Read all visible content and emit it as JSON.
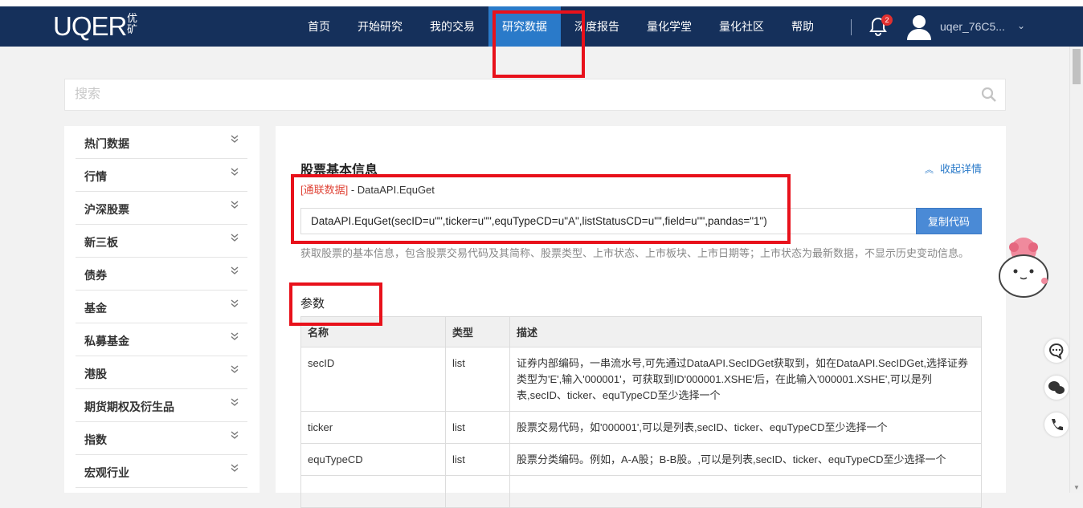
{
  "header": {
    "logo_text": "UQER",
    "logo_sub": "优矿",
    "nav": [
      {
        "label": "首页"
      },
      {
        "label": "开始研究"
      },
      {
        "label": "我的交易"
      },
      {
        "label": "研究数据",
        "active": true
      },
      {
        "label": "深度报告"
      },
      {
        "label": "量化学堂"
      },
      {
        "label": "量化社区"
      },
      {
        "label": "帮助"
      }
    ],
    "notification_count": "2",
    "username": "uqer_76C5..."
  },
  "search": {
    "placeholder": "搜索"
  },
  "sidebar": {
    "items": [
      {
        "label": "热门数据"
      },
      {
        "label": "行情"
      },
      {
        "label": "沪深股票"
      },
      {
        "label": "新三板"
      },
      {
        "label": "债券"
      },
      {
        "label": "基金"
      },
      {
        "label": "私募基金"
      },
      {
        "label": "港股"
      },
      {
        "label": "期货期权及衍生品"
      },
      {
        "label": "指数"
      },
      {
        "label": "宏观行业"
      }
    ]
  },
  "main": {
    "title": "股票基本信息",
    "collapse_label": "收起详情",
    "source_tag": "[通联数据]",
    "api_name": " - DataAPI.EquGet",
    "code": "DataAPI.EquGet(secID=u\"\",ticker=u\"\",equTypeCD=u\"A\",listStatusCD=u\"\",field=u\"\",pandas=\"1\")",
    "copy_label": "复制代码",
    "description": "获取股票的基本信息，包含股票交易代码及其简称、股票类型、上市状态、上市板块、上市日期等；上市状态为最新数据，不显示历史变动信息。",
    "params_title": "参数",
    "table": {
      "headers": [
        "名称",
        "类型",
        "描述"
      ],
      "rows": [
        {
          "name": "secID",
          "type": "list",
          "desc": "证券内部编码，一串流水号,可先通过DataAPI.SecIDGet获取到，如在DataAPI.SecIDGet,选择证券类型为'E',输入'000001'，可获取到ID'000001.XSHE'后，在此输入'000001.XSHE',可以是列表,secID、ticker、equTypeCD至少选择一个"
        },
        {
          "name": "ticker",
          "type": "list",
          "desc": "股票交易代码，如'000001',可以是列表,secID、ticker、equTypeCD至少选择一个"
        },
        {
          "name": "equTypeCD",
          "type": "list",
          "desc": "股票分类编码。例如，A-A股；B-B股。,可以是列表,secID、ticker、equTypeCD至少选择一个"
        }
      ]
    }
  },
  "colors": {
    "header_bg": "#15305b",
    "active_nav": "#2a7ac9",
    "highlight": "#e8111b",
    "button": "#4a8ad6",
    "tag": "#e0473a"
  }
}
